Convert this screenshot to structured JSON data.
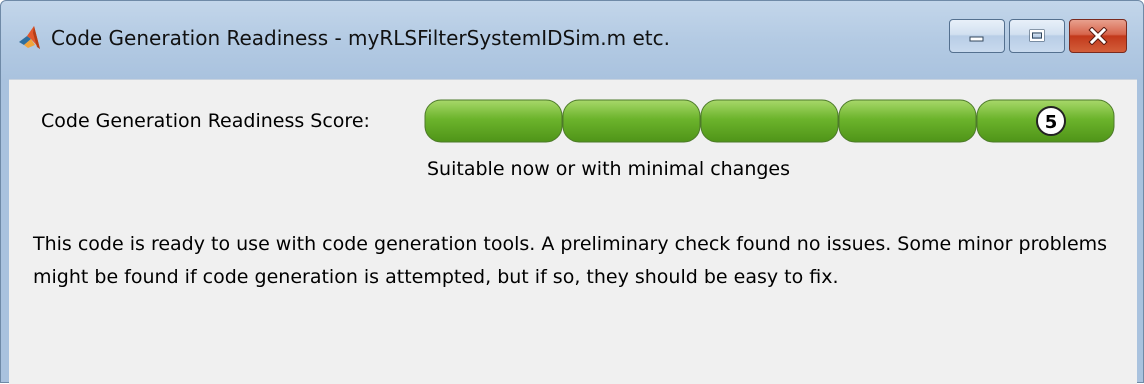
{
  "window": {
    "title": "Code Generation Readiness - myRLSFilterSystemIDSim.m etc.",
    "app_icon": "matlab-membrane-icon",
    "caption_buttons": [
      "minimize-icon",
      "maximize-icon",
      "close-icon"
    ]
  },
  "readiness": {
    "score_label": "Code Generation Readiness Score:",
    "score": "5",
    "score_value": 5,
    "score_max": 5,
    "status": "Suitable now or with minimal changes",
    "bar_color": "#5da324"
  },
  "description": "This code is ready to use with code generation tools. A preliminary check found no issues. Some minor problems might be found if code generation is attempted, but if so, they should be easy to fix."
}
